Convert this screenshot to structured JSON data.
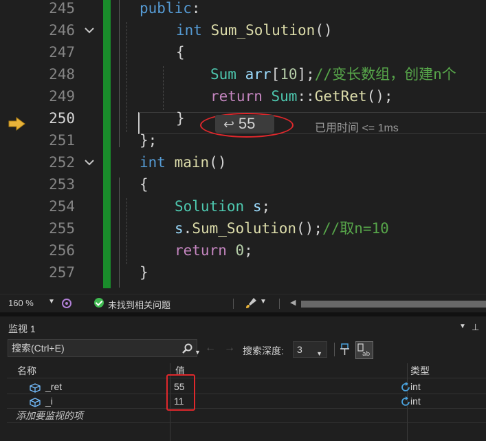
{
  "editor": {
    "current_line": 250,
    "lines": [
      {
        "num": "245",
        "tokens": [
          [
            "kw",
            "public"
          ],
          [
            "pl",
            ":"
          ]
        ]
      },
      {
        "num": "246",
        "tokens": [
          [
            "kw",
            "int"
          ],
          [
            "pl",
            " "
          ],
          [
            "fn",
            "Sum_Solution"
          ],
          [
            "pl",
            "()"
          ]
        ]
      },
      {
        "num": "247",
        "tokens": [
          [
            "pl",
            "{"
          ]
        ]
      },
      {
        "num": "248",
        "tokens": [
          [
            "ty",
            "Sum"
          ],
          [
            "pl",
            " "
          ],
          [
            "var",
            "arr"
          ],
          [
            "pl",
            "["
          ],
          [
            "num",
            "10"
          ],
          [
            "pl",
            "];"
          ],
          [
            "cm",
            "//变长数组，创建n个"
          ]
        ]
      },
      {
        "num": "249",
        "tokens": [
          [
            "kw2",
            "return"
          ],
          [
            "pl",
            " "
          ],
          [
            "ty",
            "Sum"
          ],
          [
            "pl",
            "::"
          ],
          [
            "fn",
            "GetRet"
          ],
          [
            "pl",
            "();"
          ]
        ]
      },
      {
        "num": "250",
        "tokens": [
          [
            "pl",
            "}"
          ]
        ]
      },
      {
        "num": "251",
        "tokens": [
          [
            "pl",
            "};"
          ]
        ]
      },
      {
        "num": "252",
        "tokens": [
          [
            "kw",
            "int"
          ],
          [
            "pl",
            " "
          ],
          [
            "fn",
            "main"
          ],
          [
            "pl",
            "()"
          ]
        ]
      },
      {
        "num": "253",
        "tokens": [
          [
            "pl",
            "{"
          ]
        ]
      },
      {
        "num": "254",
        "tokens": [
          [
            "ty",
            "Solution"
          ],
          [
            "pl",
            " "
          ],
          [
            "var",
            "s"
          ],
          [
            "pl",
            ";"
          ]
        ]
      },
      {
        "num": "255",
        "tokens": [
          [
            "var",
            "s"
          ],
          [
            "pl",
            "."
          ],
          [
            "fn",
            "Sum_Solution"
          ],
          [
            "pl",
            "();"
          ],
          [
            "cm",
            "//取n=10"
          ]
        ]
      },
      {
        "num": "256",
        "tokens": [
          [
            "kw2",
            "return"
          ],
          [
            "pl",
            " "
          ],
          [
            "num",
            "0"
          ],
          [
            "pl",
            ";"
          ]
        ]
      },
      {
        "num": "257",
        "tokens": [
          [
            "pl",
            "}"
          ]
        ]
      }
    ],
    "return_value": "55",
    "elapsed": "已用时间 <= 1ms"
  },
  "statusbar": {
    "zoom": "160 %",
    "issues": "未找到相关问题"
  },
  "watch": {
    "title": "监视 1",
    "search_placeholder": "搜索(Ctrl+E)",
    "depth_label": "搜索深度:",
    "depth_value": "3",
    "columns": {
      "name": "名称",
      "value": "值",
      "type": "类型"
    },
    "rows": [
      {
        "name": "_ret",
        "value": "55",
        "type": "int"
      },
      {
        "name": "_i",
        "value": "11",
        "type": "int"
      }
    ],
    "add_watch": "添加要监视的项"
  },
  "icons": [
    "execution-arrow-icon",
    "fold-chevron-icon",
    "return-arrow-icon",
    "check-icon",
    "brush-icon",
    "search-icon",
    "pin-icon",
    "hex-display-icon",
    "variable-icon",
    "refresh-icon"
  ],
  "colors": {
    "accent_red": "#e0282c",
    "change_bar": "#1a8c2b",
    "execution_arrow": "#e8b33a"
  }
}
